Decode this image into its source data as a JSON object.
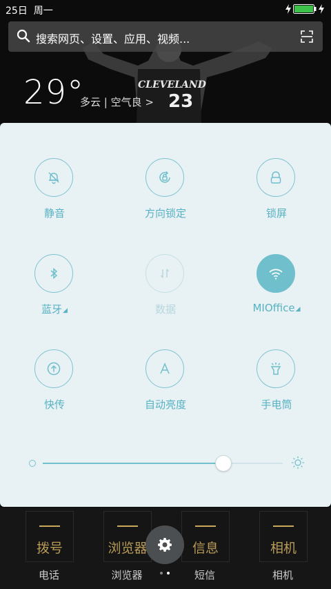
{
  "status": {
    "date": "25日",
    "weekday": "周一"
  },
  "search": {
    "placeholder": "搜索网页、设置、应用、视频..."
  },
  "weather": {
    "temperature": "29°",
    "description": "多云 | 空气良 >"
  },
  "wallpaper": {
    "jersey_text": "CLEVELAND",
    "jersey_number": "23"
  },
  "colors": {
    "accent": "#6fbfcc",
    "panel_bg": "#e8f1f3",
    "label": "#57b2c4",
    "disabled": "#b7d7de"
  },
  "toggles": [
    {
      "label": "静音",
      "icon": "bell-off-icon",
      "state": "off"
    },
    {
      "label": "方向锁定",
      "icon": "rotation-lock-icon",
      "state": "off"
    },
    {
      "label": "锁屏",
      "icon": "lock-icon",
      "state": "off"
    },
    {
      "label": "蓝牙",
      "icon": "bluetooth-icon",
      "state": "off",
      "expandable": true
    },
    {
      "label": "数据",
      "icon": "data-arrows-icon",
      "state": "disabled"
    },
    {
      "label": "MIOffice",
      "icon": "wifi-icon",
      "state": "on",
      "expandable": true
    },
    {
      "label": "快传",
      "icon": "upload-icon",
      "state": "off"
    },
    {
      "label": "自动亮度",
      "icon": "auto-brightness-icon",
      "state": "off"
    },
    {
      "label": "手电筒",
      "icon": "flashlight-icon",
      "state": "off"
    }
  ],
  "brightness": {
    "level": 0.75
  },
  "dock": [
    {
      "label": "电话",
      "glyph": "拨号"
    },
    {
      "label": "浏览器",
      "glyph": "浏览器"
    },
    {
      "label": "短信",
      "glyph": "信息"
    },
    {
      "label": "相机",
      "glyph": "相机"
    }
  ],
  "pager": {
    "pages": 2,
    "current": 2
  }
}
